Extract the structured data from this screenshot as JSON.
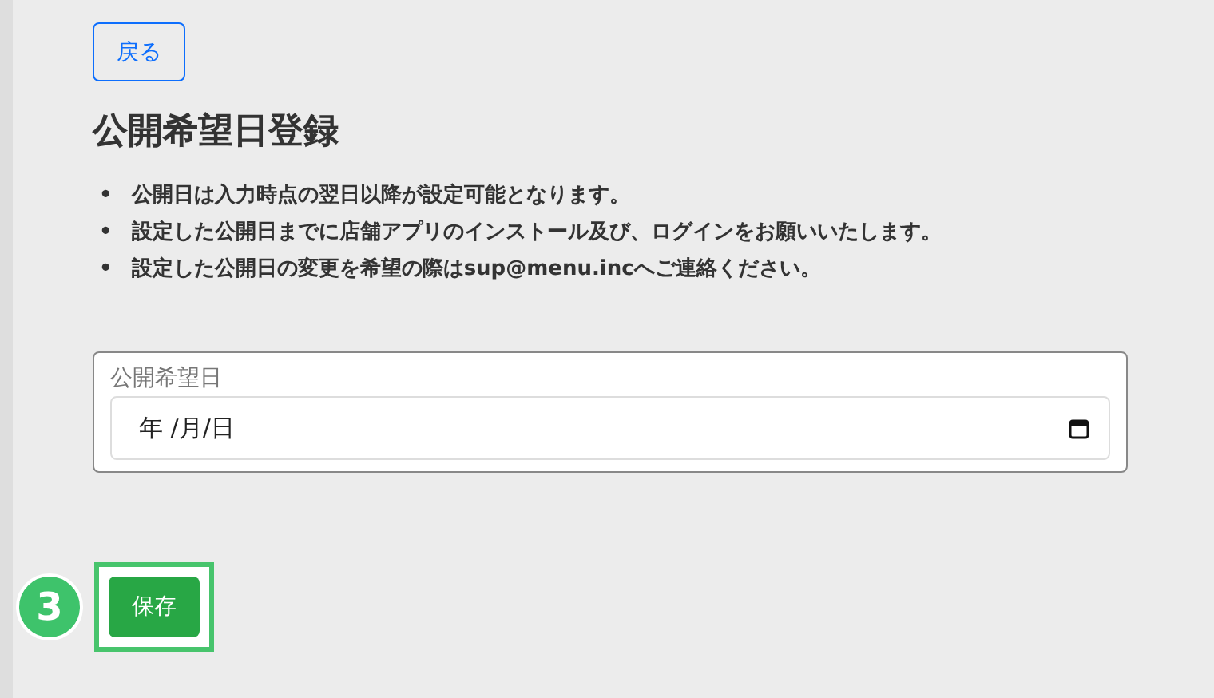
{
  "back_button": {
    "label": "戻る"
  },
  "title": "公開希望日登録",
  "notes": [
    {
      "bullet": "•",
      "text": "公開日は入力時点の翌日以降が設定可能となります。"
    },
    {
      "bullet": "•",
      "text": "設定した公開日までに店舗アプリのインストール及び、ログインをお願いいたします。"
    },
    {
      "bullet": "•",
      "text": "設定した公開日の変更を希望の際はsup@menu.incへご連絡ください。"
    }
  ],
  "date_field": {
    "label": "公開希望日",
    "placeholder": "年 /月/日"
  },
  "step_badge": "3",
  "save_button": {
    "label": "保存",
    "highlighted": true
  }
}
